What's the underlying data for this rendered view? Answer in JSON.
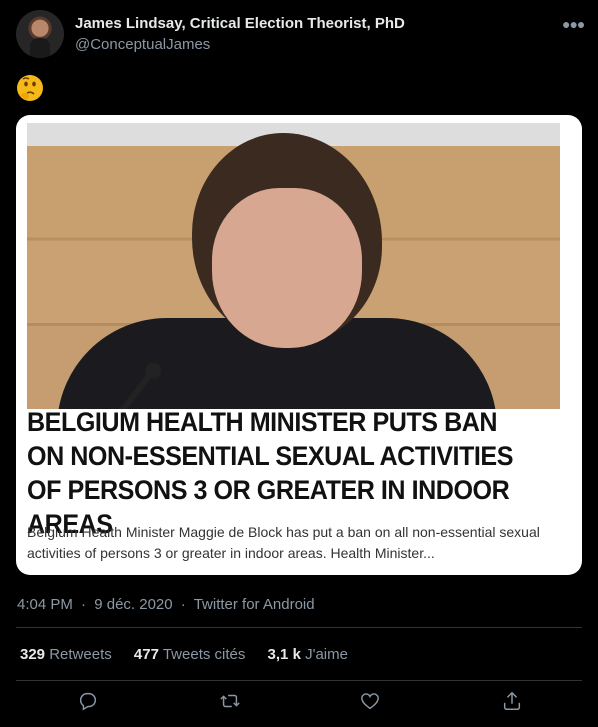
{
  "tweet": {
    "author_name": "James Lindsay, Critical Election Theorist, PhD",
    "handle": "@ConceptualJames",
    "emoji": "🤔",
    "time": "4:04 PM",
    "date": "9 déc. 2020",
    "source": "Twitter for Android",
    "sep": "·"
  },
  "card": {
    "headline": "BELGIUM HEALTH MINISTER PUTS BAN ON NON-ESSENTIAL SEXUAL ACTIVITIES OF PERSONS 3 OR GREATER IN INDOOR AREAS",
    "description": "Belgium Health Minister Maggie de Block has put a ban on all non-essential sexual activities of persons 3 or greater in indoor areas. Health Minister..."
  },
  "stats": {
    "retweets_count": "329",
    "retweets_label": "Retweets",
    "quotes_count": "477",
    "quotes_label": "Tweets cités",
    "likes_count": "3,1 k",
    "likes_label": "J'aime"
  },
  "icons": {
    "more": "more-icon",
    "reply": "reply-icon",
    "retweet": "retweet-icon",
    "like": "heart-icon",
    "share": "share-icon"
  },
  "colors": {
    "background": "#000000",
    "muted": "#8b98a5",
    "text": "#e7e9ea",
    "divider": "#2f3336"
  }
}
